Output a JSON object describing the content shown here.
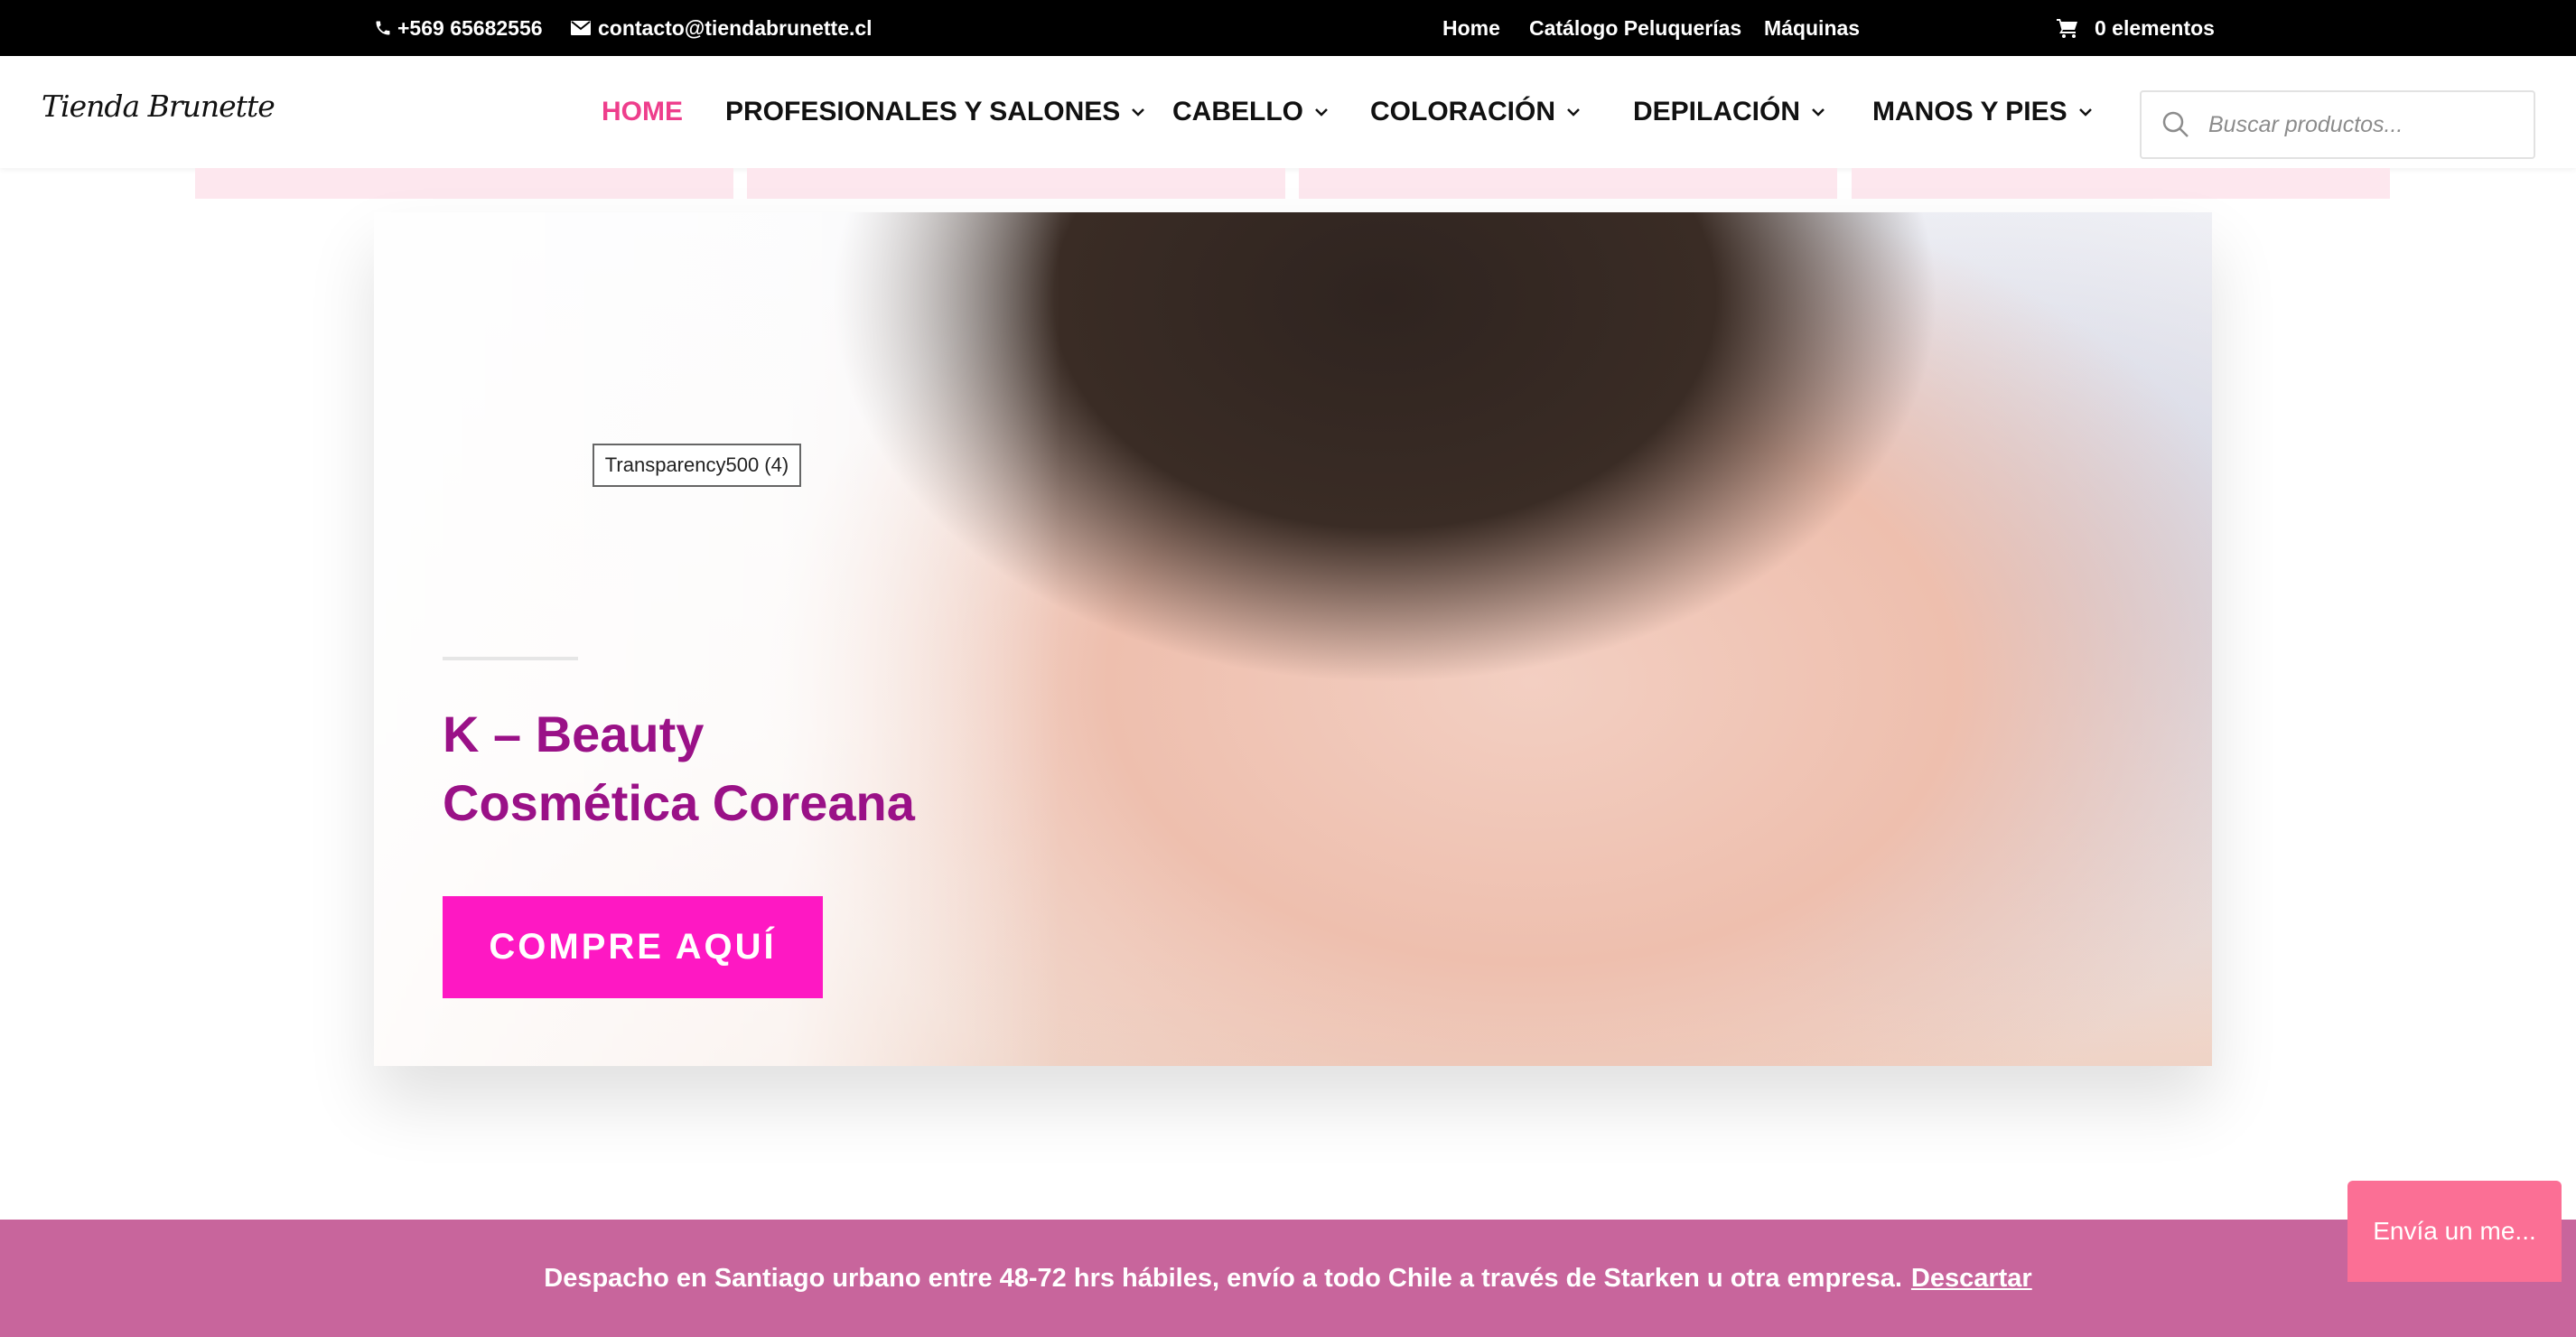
{
  "topbar": {
    "phone": "+569 65682556",
    "email": "contacto@tiendabrunette.cl",
    "links": [
      "Home",
      "Catálogo Peluquerías",
      "Máquinas"
    ],
    "cart": "0 elementos"
  },
  "header": {
    "logo": "Tienda Brunette",
    "nav": [
      {
        "label": "HOME",
        "active": true
      },
      {
        "label": "PROFESIONALES Y SALONES",
        "dropdown": true
      },
      {
        "label": "CABELLO",
        "dropdown": true
      },
      {
        "label": "COLORACIÓN",
        "dropdown": true
      },
      {
        "label": "DEPILACIÓN",
        "dropdown": true
      },
      {
        "label": "MANOS Y PIES",
        "dropdown": true
      }
    ],
    "search_placeholder": "Buscar productos..."
  },
  "hero": {
    "image_label": "Transparency500 (4)",
    "title_line1": "K – Beauty",
    "title_line2": "Cosmética Coreana",
    "cta": "COMPRE AQUÍ"
  },
  "notice": {
    "text": "Despacho en Santiago urbano entre 48-72 hrs hábiles, envío a todo Chile a través de Starken u otra empresa.",
    "dismiss": "Descartar"
  },
  "chat": {
    "label": "Envía un me..."
  },
  "colors": {
    "topbar_bg": "#000000",
    "nav_active": "#ee3e8c",
    "hero_title": "#9a1187",
    "cta_bg": "#fe18c3",
    "notice_bg": "#c8659c",
    "chat_bg": "#fb6f95"
  },
  "icons": [
    "phone-icon",
    "mail-icon",
    "cart-icon",
    "chevron-down-icon",
    "search-icon"
  ]
}
